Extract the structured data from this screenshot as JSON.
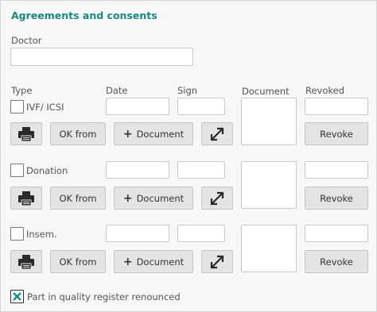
{
  "section": {
    "title": "Agreements and consents",
    "doctor_label": "Doctor",
    "doctor_value": ""
  },
  "headers": {
    "type": "Type",
    "date": "Date",
    "sign": "Sign",
    "document": "Document",
    "revoked": "Revoked"
  },
  "rows": [
    {
      "type_label": "IVF/ ICSI",
      "checked": false,
      "date": "",
      "sign": "",
      "revoked": "",
      "ok_label": "OK from",
      "doc_label": "Document",
      "revoke_label": "Revoke"
    },
    {
      "type_label": "Donation",
      "checked": false,
      "date": "",
      "sign": "",
      "revoked": "",
      "ok_label": "OK from",
      "doc_label": "Document",
      "revoke_label": "Revoke"
    },
    {
      "type_label": "Insem.",
      "checked": false,
      "date": "",
      "sign": "",
      "revoked": "",
      "ok_label": "OK from",
      "doc_label": "Document",
      "revoke_label": "Revoke"
    }
  ],
  "quality": {
    "label": "Part in quality register renounced",
    "checked": true
  },
  "icons": {
    "printer": "printer-icon",
    "expand": "expand-diagonal-icon",
    "plus": "plus-icon",
    "check": "check-x-icon"
  },
  "colors": {
    "accent": "#1a8a86"
  }
}
